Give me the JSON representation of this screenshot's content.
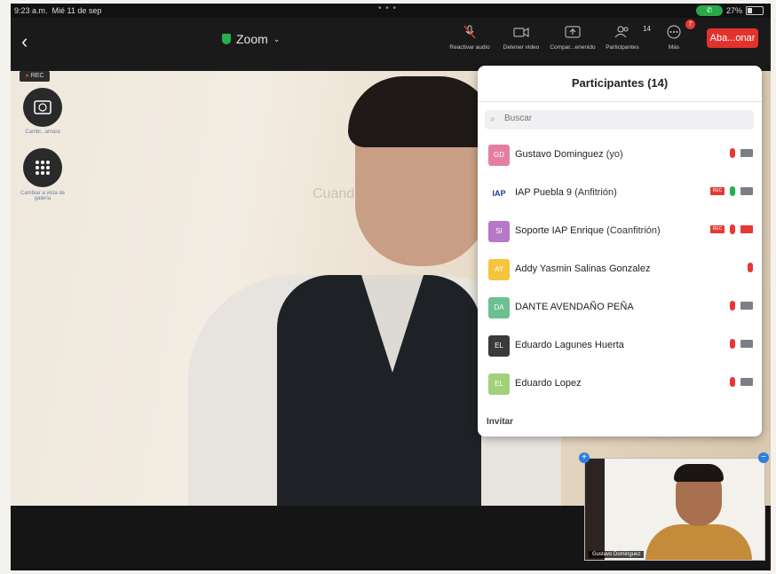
{
  "status_bar": {
    "time": "9:23 a.m.",
    "date": "Mié 11 de sep",
    "battery": "27%"
  },
  "toolbar": {
    "title": "Zoom",
    "buttons": [
      {
        "label": "Reactivar audio",
        "icon": "mic-muted-icon"
      },
      {
        "label": "Detener video",
        "icon": "video-icon"
      },
      {
        "label": "Compar...enenido",
        "icon": "share-icon"
      },
      {
        "label": "Participantes",
        "icon": "participants-icon"
      },
      {
        "label": "Más",
        "icon": "more-icon"
      }
    ],
    "participant_count": "14",
    "more_badge": "7",
    "leave_label": "Aba...onar"
  },
  "side": {
    "rec": "REC",
    "btn1_label": "Cambi...amara",
    "btn2_label": "Cambiar a vista de galería"
  },
  "participants": {
    "title": "Participantes (14)",
    "search_placeholder": "Buscar",
    "invite_label": "Invitar",
    "list": [
      {
        "initials": "GD",
        "name": "Gustavo Dominguez",
        "role": "(yo)",
        "color": "#e57ea1",
        "mic": "off",
        "cam": "on",
        "rec": false
      },
      {
        "initials": "IAP",
        "name": "IAP Puebla 9",
        "role": "(Anfitrión)",
        "color": "#ffffff",
        "mic": "on",
        "cam": "on",
        "rec": true
      },
      {
        "initials": "SI",
        "name": "Soporte IAP Enrique",
        "role": "(Coanfitrión)",
        "color": "#b678c9",
        "mic": "off",
        "cam": "off",
        "rec": true
      },
      {
        "initials": "AY",
        "name": "Addy Yasmin Salinas Gonzalez",
        "role": "",
        "color": "#f6c53d",
        "mic": "off",
        "cam": "none",
        "rec": false
      },
      {
        "initials": "DA",
        "name": "DANTE AVENDAÑO PEÑA",
        "role": "",
        "color": "#6cc08f",
        "mic": "off",
        "cam": "on",
        "rec": false
      },
      {
        "initials": "EL",
        "name": "Eduardo Lagunes Huerta",
        "role": "",
        "color": "#3a3a3a",
        "mic": "off",
        "cam": "on",
        "rec": false
      },
      {
        "initials": "EL",
        "name": "Eduardo Lopez",
        "role": "",
        "color": "#a3d07b",
        "mic": "off",
        "cam": "on",
        "rec": false
      }
    ]
  },
  "self_view": {
    "name": "Gustavo Dominguez"
  }
}
